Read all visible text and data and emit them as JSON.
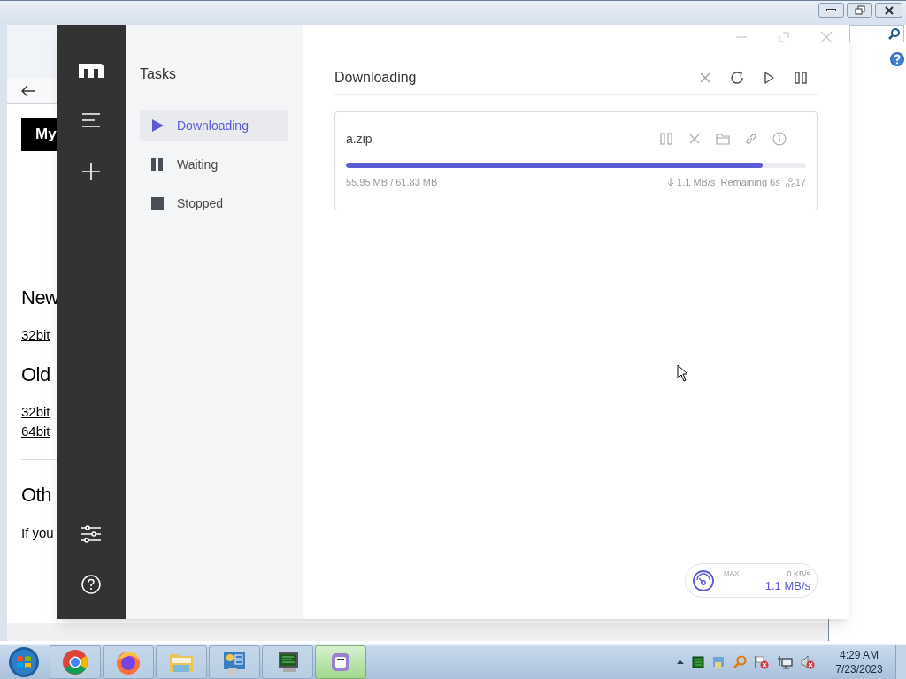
{
  "browser": {
    "page": [
      {
        "kind": "badge",
        "text": "My"
      },
      {
        "kind": "heading",
        "text": "New"
      },
      {
        "kind": "link",
        "text": "32bit"
      },
      {
        "kind": "heading",
        "text": "Old"
      },
      {
        "kind": "link",
        "text": "32bit"
      },
      {
        "kind": "link",
        "text": "64bit"
      },
      {
        "kind": "divider"
      },
      {
        "kind": "heading",
        "text": "Oth"
      },
      {
        "kind": "text",
        "text": "If you"
      }
    ]
  },
  "app": {
    "tasks_panel": {
      "title": "Tasks",
      "items": [
        {
          "label": "Downloading",
          "kind": "play",
          "selected": true
        },
        {
          "label": "Waiting",
          "kind": "pause",
          "selected": false
        },
        {
          "label": "Stopped",
          "kind": "stop",
          "selected": false
        }
      ]
    },
    "main": {
      "title": "Downloading",
      "tasks": [
        {
          "name": "a.zip",
          "level": 0.905,
          "size": "55.95 MB / 61.83 MB",
          "speed": "1.1 MB/s",
          "remaining": "Remaining 6s",
          "connections": "17"
        }
      ]
    },
    "speedometer": {
      "label": "MAX",
      "upload": "0 KB/s",
      "download": "1.1 MB/s"
    }
  },
  "taskbar": {
    "apps": [
      {
        "kind": "chrome",
        "active": false
      },
      {
        "kind": "firefox",
        "active": false
      },
      {
        "kind": "folder",
        "active": false
      },
      {
        "kind": "control-panel",
        "active": false
      },
      {
        "kind": "monitor",
        "active": false
      },
      {
        "kind": "motrix",
        "active": true
      }
    ],
    "time": "4:29 AM",
    "date": "7/23/2023"
  }
}
